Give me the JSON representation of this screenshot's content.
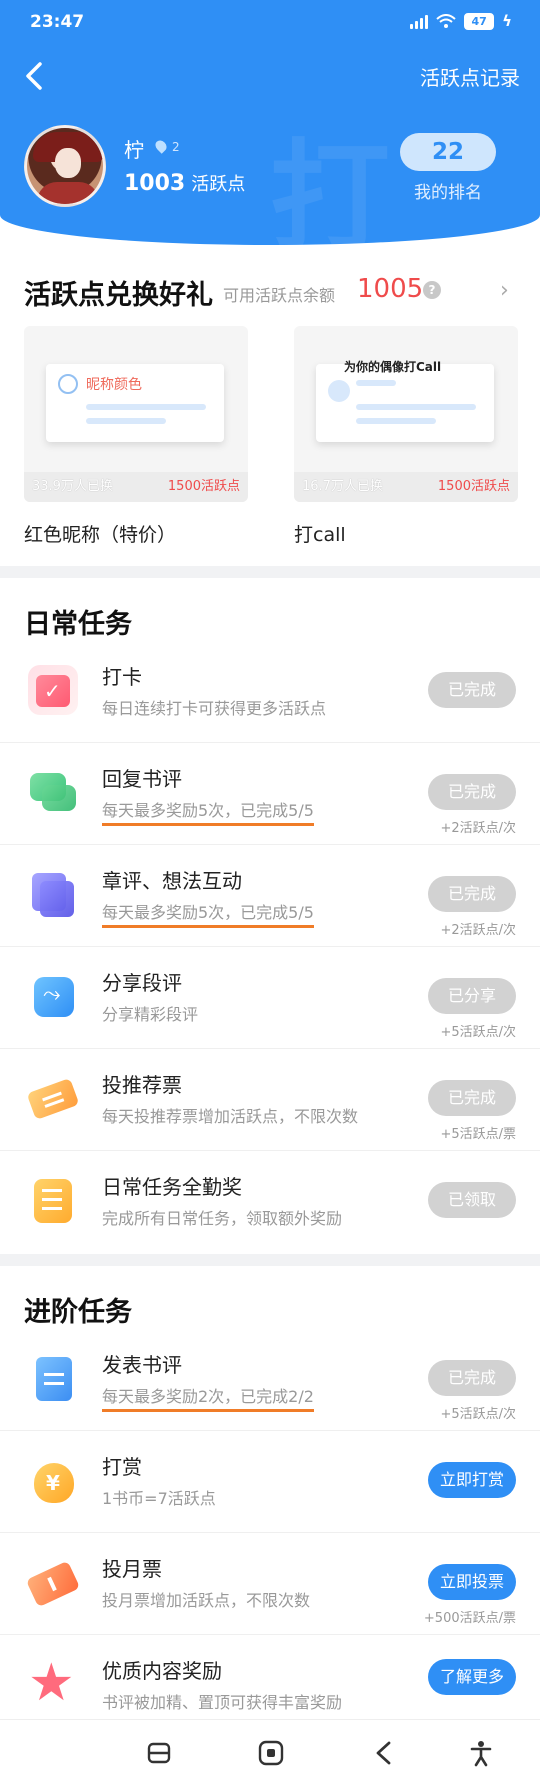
{
  "status": {
    "time": "23:47",
    "battery": "47"
  },
  "header": {
    "records_label": "活跃点记录",
    "bg_char": "打"
  },
  "user": {
    "name": "柠",
    "level": "2",
    "points": "1003",
    "points_unit": "活跃点",
    "rank": "22",
    "rank_label": "我的排名"
  },
  "exchange": {
    "title": "活跃点兑换好礼",
    "balance_label": "可用活跃点余额",
    "balance": "1005",
    "question": "?",
    "arrow": "›",
    "items": [
      {
        "card_text": "昵称颜色",
        "count": "33.9万人已换",
        "cost": "1500活跃点",
        "name": "红色昵称（特价）"
      },
      {
        "card_text": "为你的偶像打Call",
        "count": "16.7万人已换",
        "cost": "1500活跃点",
        "name": "打call"
      }
    ]
  },
  "daily": {
    "title": "日常任务",
    "tasks": [
      {
        "name": "打卡",
        "desc": "每日连续打卡可获得更多活跃点",
        "button": "已完成",
        "reward": "",
        "icon": "calendar-check-icon"
      },
      {
        "name": "回复书评",
        "desc": "每天最多奖励5次，已完成5/5",
        "button": "已完成",
        "reward": "+2活跃点/次",
        "icon": "chat-bubbles-icon"
      },
      {
        "name": "章评、想法互动",
        "desc": "每天最多奖励5次，已完成5/5",
        "button": "已完成",
        "reward": "+2活跃点/次",
        "icon": "notes-icon"
      },
      {
        "name": "分享段评",
        "desc": "分享精彩段评",
        "button": "已分享",
        "reward": "+5活跃点/次",
        "icon": "share-icon"
      },
      {
        "name": "投推荐票",
        "desc": "每天投推荐票增加活跃点，不限次数",
        "button": "已完成",
        "reward": "+5活跃点/票",
        "icon": "ticket-icon"
      },
      {
        "name": "日常任务全勤奖",
        "desc": "完成所有日常任务，领取额外奖励",
        "button": "已领取",
        "reward": "",
        "icon": "list-icon"
      }
    ]
  },
  "advanced": {
    "title": "进阶任务",
    "tasks": [
      {
        "name": "发表书评",
        "desc": "每天最多奖励2次，已完成2/2",
        "button": "已完成",
        "reward": "+5活跃点/次",
        "icon": "document-icon"
      },
      {
        "name": "打赏",
        "desc": "1书币=7活跃点",
        "button": "立即打赏",
        "reward": "",
        "icon": "money-bag-icon"
      },
      {
        "name": "投月票",
        "desc": "投月票增加活跃点，不限次数",
        "button": "立即投票",
        "reward": "+500活跃点/票",
        "icon": "monthly-ticket-icon"
      },
      {
        "name": "优质内容奖励",
        "desc": "书评被加精、置顶可获得丰富奖励",
        "button": "了解更多",
        "reward": "",
        "icon": "star-icon"
      }
    ]
  },
  "colors": {
    "primary": "#2f8ff5",
    "accent_red": "#ef4b4b",
    "done_gray": "#d2d2d2",
    "underline_orange": "#f07c28"
  }
}
